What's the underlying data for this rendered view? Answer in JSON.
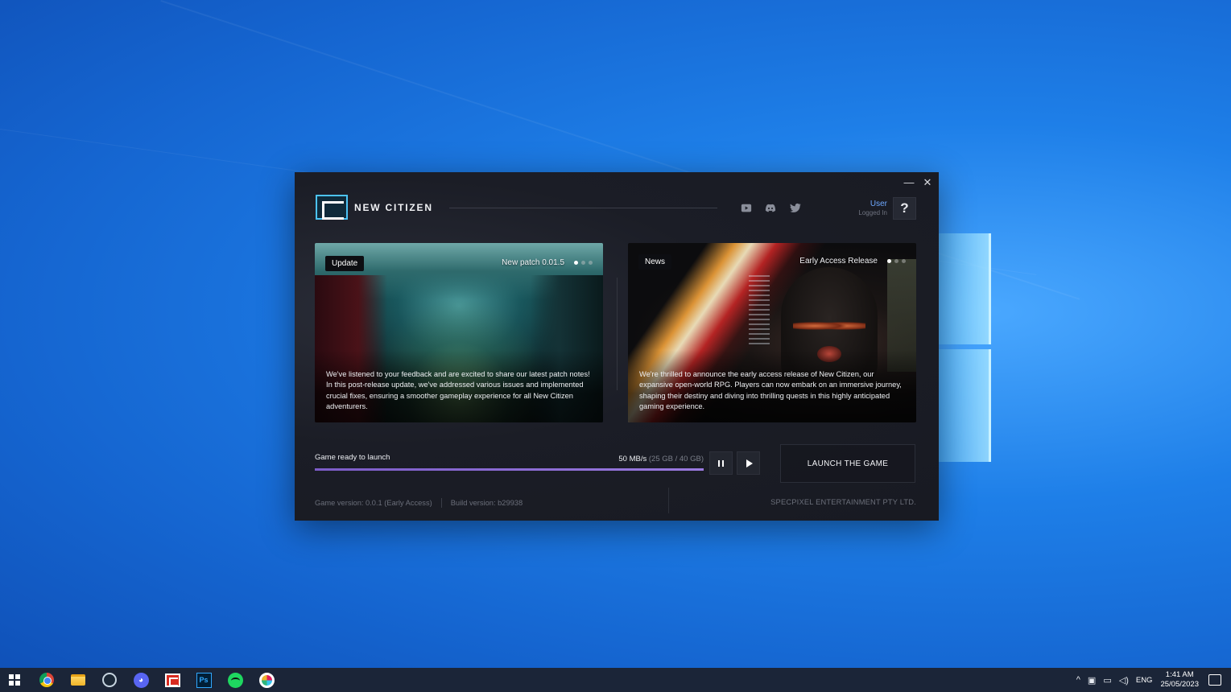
{
  "launcher": {
    "window": {
      "minimize": "—",
      "close": "✕"
    },
    "brand": {
      "name": "NEW CITIZEN"
    },
    "social": [
      "youtube-icon",
      "discord-icon",
      "twitter-icon"
    ],
    "user": {
      "name": "User",
      "status": "Logged In",
      "help": "?"
    },
    "cards": [
      {
        "badge": "Update",
        "title": "New patch 0.01.5",
        "text": "We've listened to your feedback and are excited to share our latest patch notes! In this post-release update, we've addressed various issues and implemented crucial fixes, ensuring a smoother gameplay experience for all New Citizen adventurers."
      },
      {
        "badge": "News",
        "title": "Early Access Release",
        "text": "We're thrilled to announce the early access release of New Citizen, our expansive open-world RPG. Players can now embark on an immersive journey, shaping their destiny and diving into thrilling quests in this highly anticipated gaming experience."
      }
    ],
    "download": {
      "status": "Game ready to launch",
      "speed": "50 MB/s",
      "progress_text": "(25 GB / 40 GB)",
      "progress_fraction": 1.0
    },
    "launch_label": "LAUNCH THE GAME",
    "footer": {
      "game_version": "Game version: 0.0.1 (Early Access)",
      "build_version": "Build version: b29938",
      "publisher": "SPECPIXEL ENTERTAINMENT PTY LTD."
    }
  },
  "taskbar": {
    "apps": [
      "start-icon",
      "chrome-icon",
      "file-explorer-icon",
      "steam-icon",
      "discord-icon",
      "new-citizen-icon",
      "photoshop-icon",
      "spotify-icon",
      "slack-icon"
    ],
    "photoshop_label": "Ps",
    "tray": {
      "chevron": "^",
      "lang": "ENG",
      "time": "1:41 AM",
      "date": "25/05/2023"
    }
  }
}
